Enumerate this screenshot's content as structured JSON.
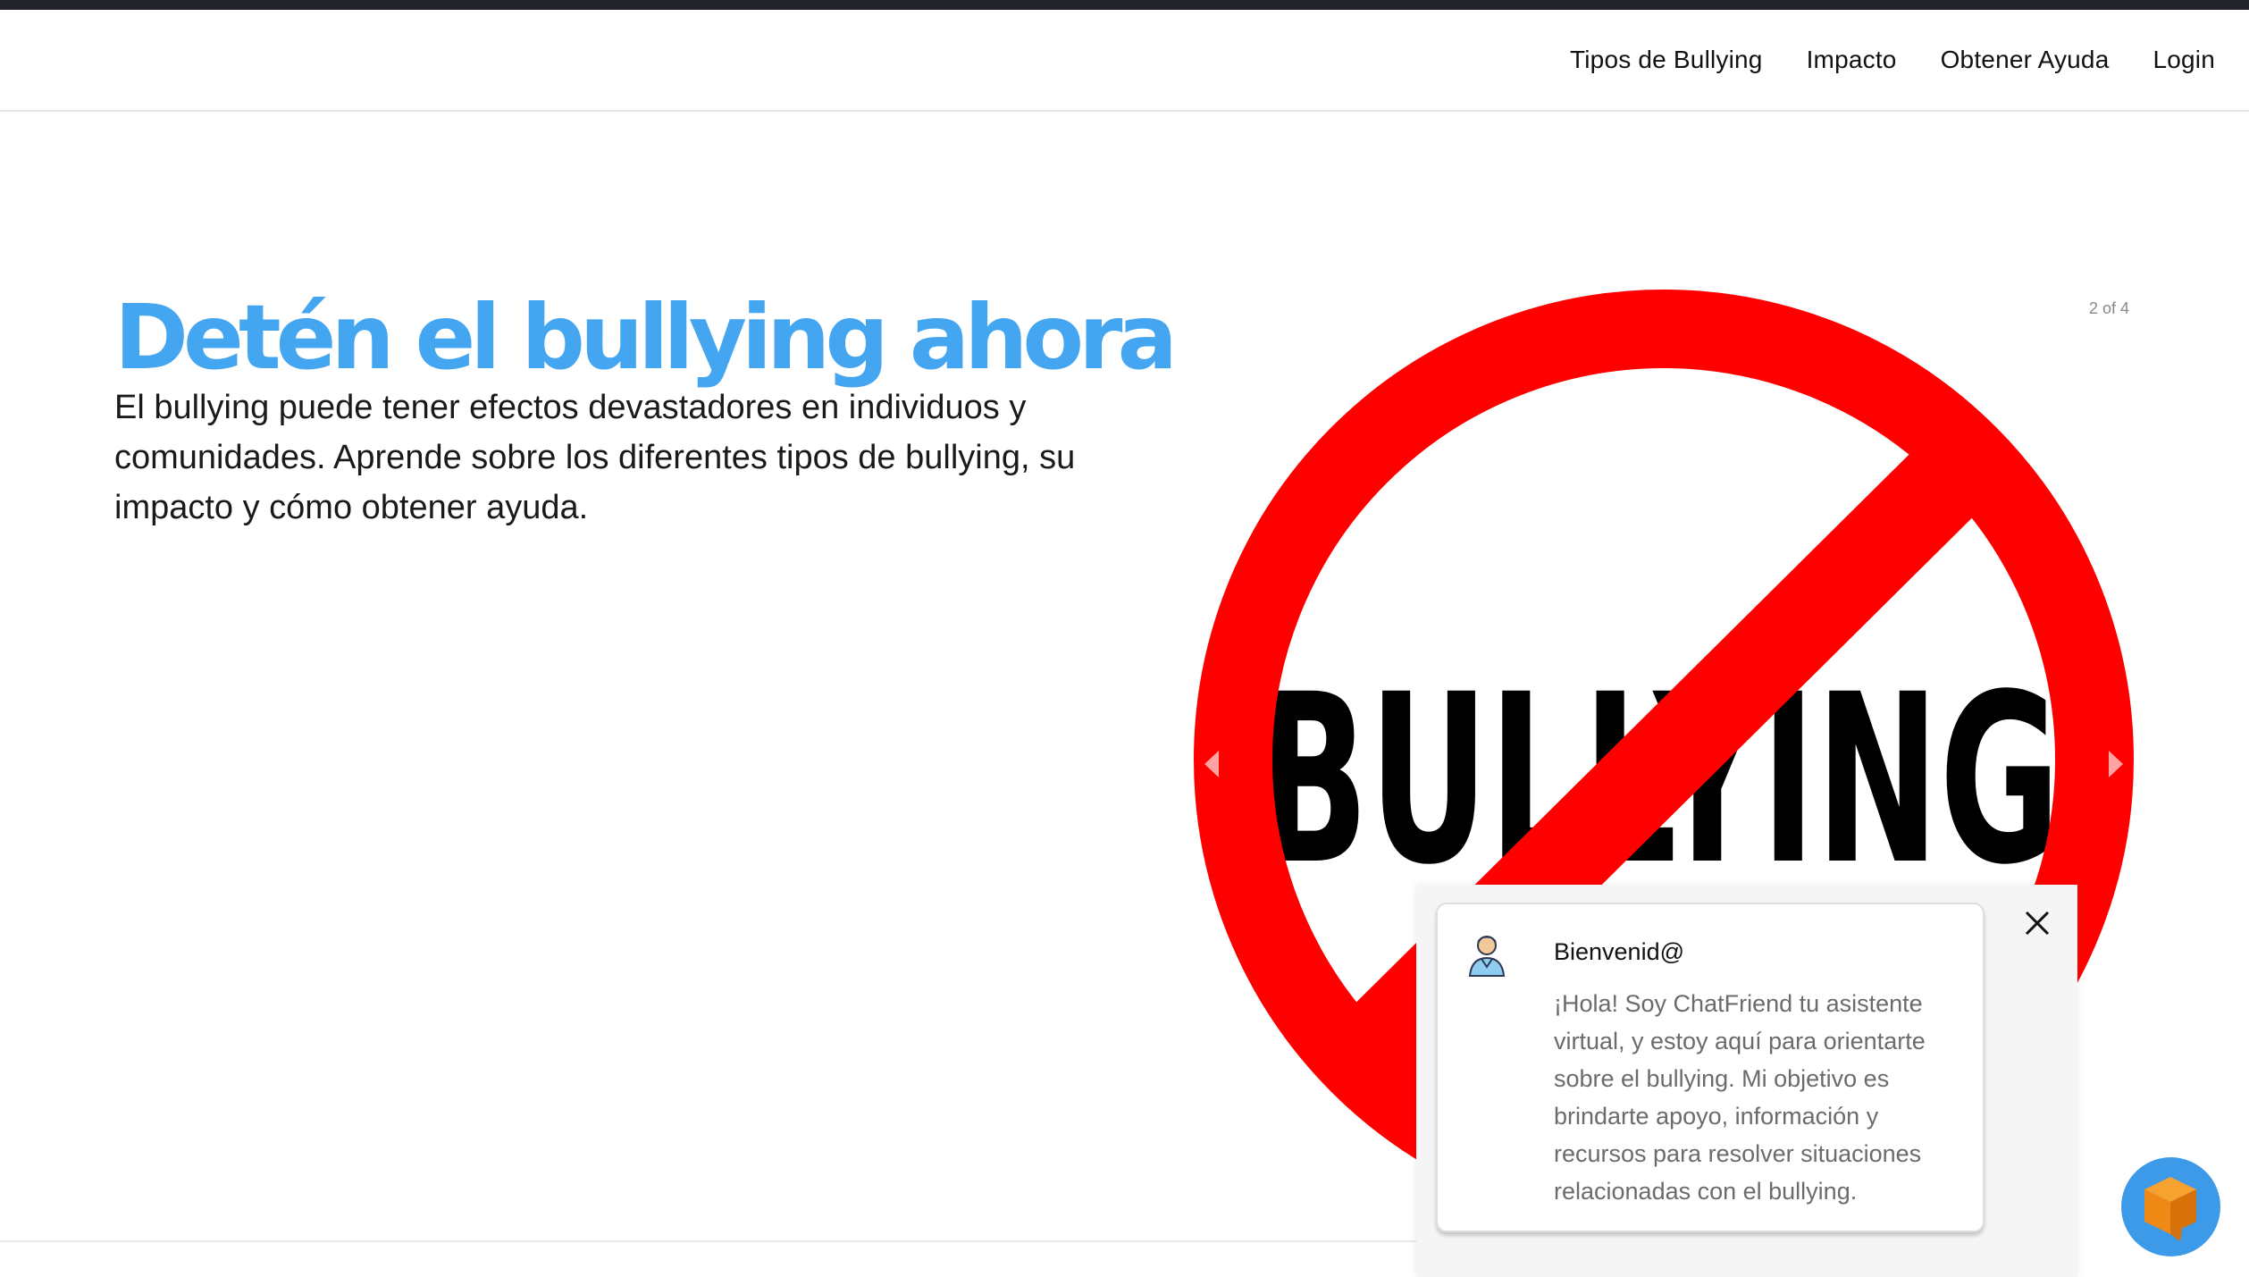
{
  "nav": {
    "links": [
      "Tipos de Bullying",
      "Impacto",
      "Obtener Ayuda",
      "Login"
    ]
  },
  "hero": {
    "title": "Detén el bullying ahora",
    "description": "El bullying puede tener efectos devastadores en individuos y comunidades. Aprende sobre los diferentes tipos de bullying, su impacto y cómo obtener ayuda."
  },
  "carousel": {
    "counter": "2 of 4",
    "slide_text": "BULLYING"
  },
  "chat": {
    "greeting": "Bienvenid@",
    "message": "¡Hola! Soy ChatFriend tu asistente virtual, y estoy aquí para orientarte sobre el bullying. Mi objetivo es brindarte apoyo, información y recursos para resolver situaciones relacionadas con el bullying."
  },
  "colors": {
    "title": "#44a6f0",
    "prohibition_sign": "#ff0000",
    "launcher": "#3d9ae8",
    "launcher_icon": "#f08a16"
  },
  "icons": {
    "avatar": "assistant-avatar-icon",
    "close": "close-icon",
    "launcher": "chat-cube-icon"
  }
}
